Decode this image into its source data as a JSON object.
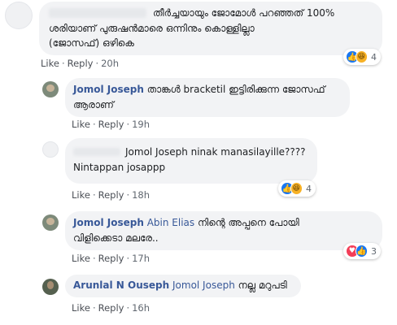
{
  "comments": [
    {
      "text_line1": "തീർച്ചയായും ജോമോൾ പറഞ്ഞത് 100%",
      "text_line2": "ശരിയാണ് പുരുഷൻമാരെ ഒന്നിനും കൊള്ളില്ലാ",
      "text_line3": "(ജോസഫ്) ഒഴികെ",
      "like": "Like",
      "reply": "Reply",
      "time": "20h",
      "reaction_count": "4",
      "reactions": [
        "like-icon",
        "haha-icon"
      ]
    },
    {
      "author": "Jomol Joseph",
      "text_line1": "താങ്കൾ bracketil ഇട്ടിരിക്കുന്ന ജോസഫ്",
      "text_line2": "ആരാണ്",
      "like": "Like",
      "reply": "Reply",
      "time": "19h"
    },
    {
      "text_line1": "Jomol Joseph ninak manasilayille????",
      "text_line2": "Nintappan josappp",
      "like": "Like",
      "reply": "Reply",
      "time": "18h",
      "reaction_count": "4",
      "reactions": [
        "like-icon",
        "haha-icon"
      ]
    },
    {
      "author": "Jomol Joseph",
      "tag": "Abin Elias",
      "text_line1": "നിന്റെ അപ്പനെ പോയി",
      "text_line2": "വിളിക്കെടാ മലരേ..",
      "like": "Like",
      "reply": "Reply",
      "time": "17h",
      "reaction_count": "3",
      "reactions": [
        "love-icon",
        "like-icon"
      ]
    },
    {
      "author": "Arunlal N Ouseph",
      "tag": "Jomol Joseph",
      "text": "നല്ല മറുപടി",
      "like": "Like",
      "reply": "Reply",
      "time": "16h"
    }
  ],
  "colors": {
    "link": "#385898",
    "bubble": "#f2f3f5",
    "meta": "#606770",
    "like_reaction": "#1877f2",
    "haha_reaction": "#f7b125",
    "love_reaction": "#f33e58"
  }
}
